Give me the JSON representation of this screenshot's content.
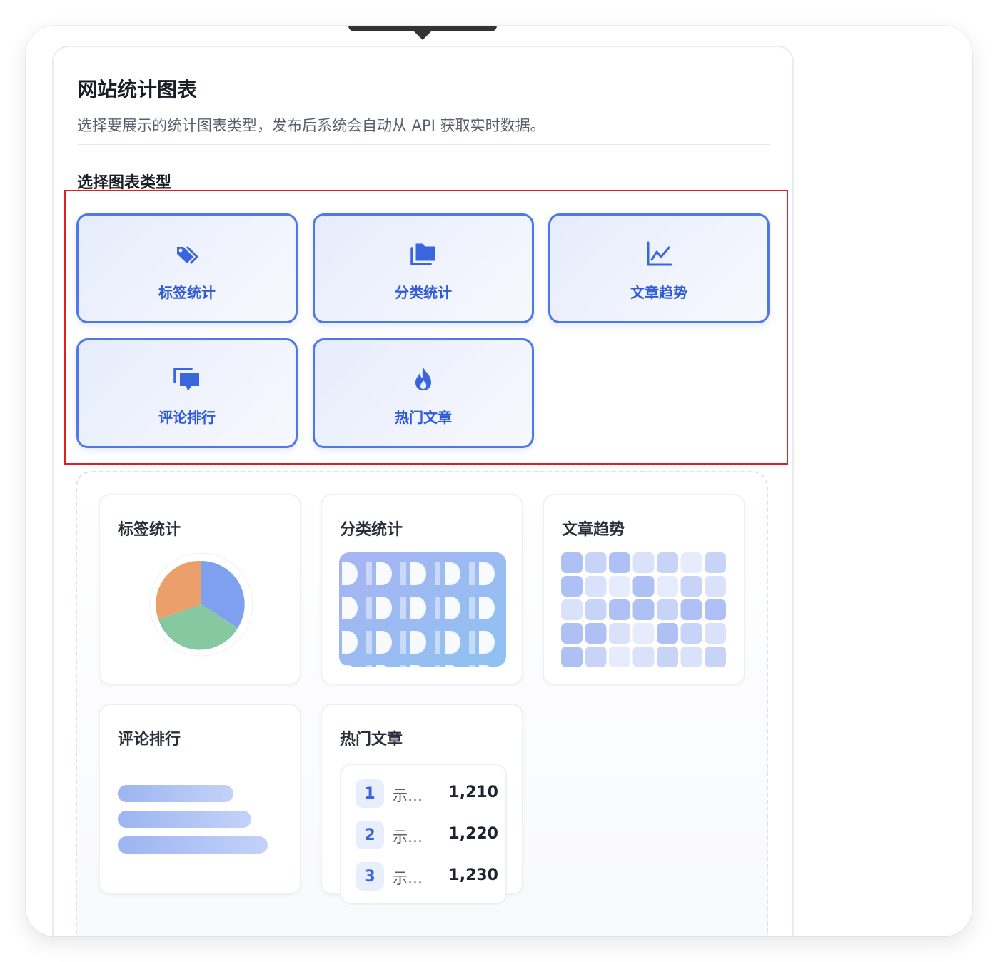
{
  "panel": {
    "title": "网站统计图表",
    "description": "选择要展示的统计图表类型，发布后系统会自动从 API 获取实时数据。",
    "section_label": "选择图表类型"
  },
  "chart_types": [
    {
      "label": "标签统计",
      "icon": "tags-icon"
    },
    {
      "label": "分类统计",
      "icon": "folders-icon"
    },
    {
      "label": "文章趋势",
      "icon": "line-chart-icon"
    },
    {
      "label": "评论排行",
      "icon": "comments-icon"
    },
    {
      "label": "热门文章",
      "icon": "fire-icon"
    }
  ],
  "previews": {
    "tags": {
      "title": "标签统计"
    },
    "categories": {
      "title": "分类统计"
    },
    "trend": {
      "title": "文章趋势"
    },
    "comments": {
      "title": "评论排行",
      "bar_fractions": [
        0.77,
        0.89,
        1.0
      ]
    },
    "hot": {
      "title": "热门文章",
      "items": [
        {
          "rank": "1",
          "title": "示…",
          "value": "1,210"
        },
        {
          "rank": "2",
          "title": "示…",
          "value": "1,220"
        },
        {
          "rank": "3",
          "title": "示…",
          "value": "1,230"
        }
      ]
    }
  },
  "colors": {
    "accent": "#3a66dd",
    "pie": [
      "#7fa0ee",
      "#86c9a0",
      "#eba06c"
    ],
    "highlight": "#e02020"
  }
}
